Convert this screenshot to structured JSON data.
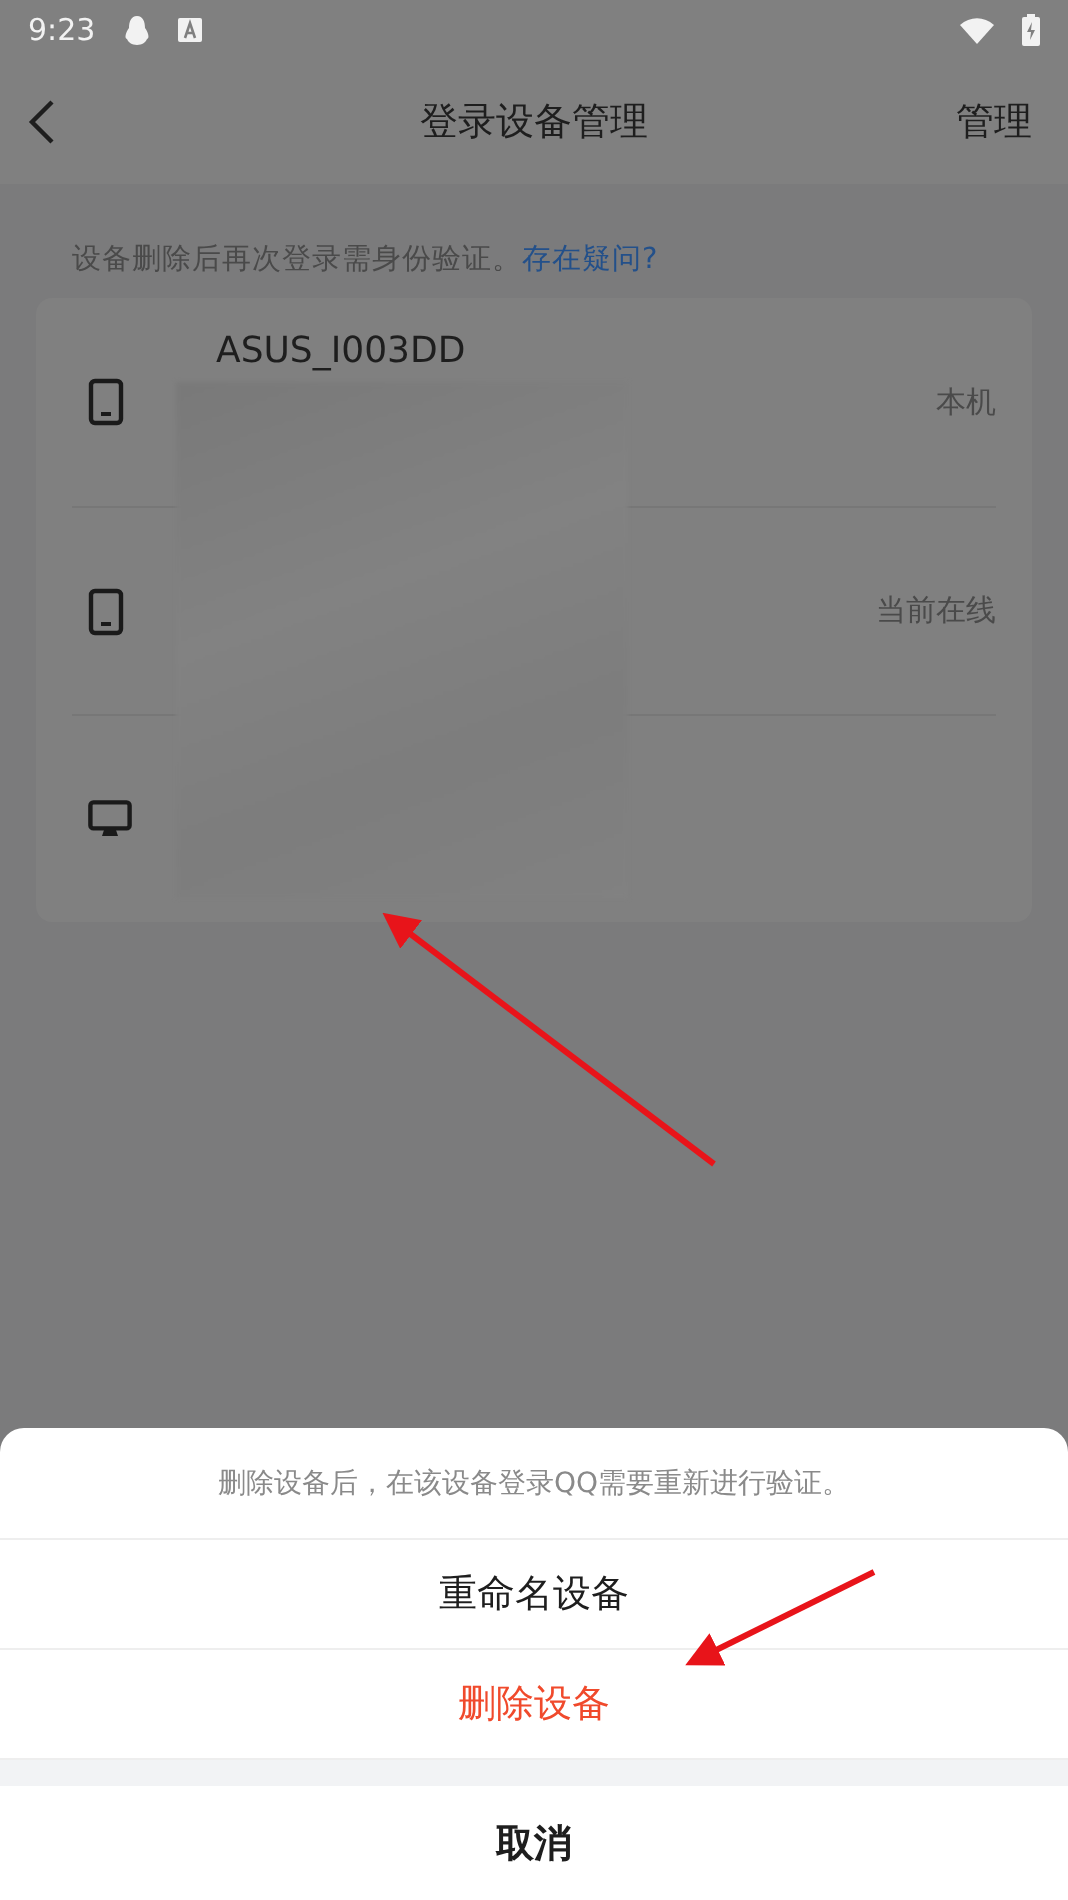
{
  "status_bar": {
    "time": "9:23"
  },
  "nav": {
    "title": "登录设备管理",
    "action": "管理"
  },
  "notice": {
    "text": "设备删除后再次登录需身份验证。",
    "link": "存在疑问?"
  },
  "devices": [
    {
      "kind": "phone",
      "name": "ASUS_I003DD",
      "status": "本机"
    },
    {
      "kind": "phone",
      "status": "当前在线"
    },
    {
      "kind": "desktop"
    }
  ],
  "sheet": {
    "hint": "删除设备后，在该设备登录QQ需要重新进行验证。",
    "actions": [
      {
        "label": "重命名设备",
        "kind": "normal"
      },
      {
        "label": "删除设备",
        "kind": "danger"
      }
    ],
    "cancel": "取消"
  }
}
